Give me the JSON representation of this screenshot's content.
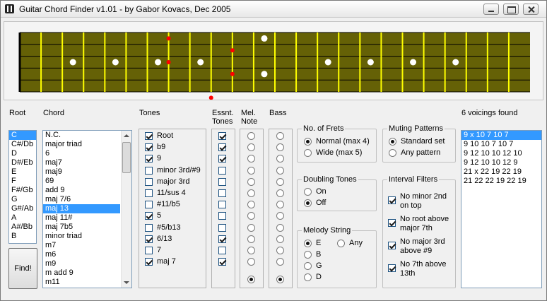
{
  "window": {
    "title": "Guitar Chord Finder  v1.01 - by Gabor Kovacs, Dec 2005"
  },
  "labels": {
    "root": "Root",
    "chord": "Chord",
    "tones": "Tones",
    "essnt1": "Essnt.",
    "essnt2": "Tones",
    "mel1": "Mel.",
    "mel2": "Note",
    "bass": "Bass",
    "voicings": "6 voicings found"
  },
  "roots": [
    "C",
    "C#/Db",
    "D",
    "D#/Eb",
    "E",
    "F",
    "F#/Gb",
    "G",
    "G#/Ab",
    "A",
    "A#/Bb",
    "B"
  ],
  "root_selected": 0,
  "chords": [
    "N.C.",
    "major triad",
    "6",
    "maj7",
    "maj9",
    "69",
    "add 9",
    "maj 7/6",
    "maj 13",
    "maj 11#",
    "maj 7b5",
    "minor triad",
    "m7",
    "m6",
    "m9",
    "m add 9",
    "m11"
  ],
  "chord_selected": 8,
  "tones": [
    {
      "label": "Root",
      "checked": true,
      "essential": true,
      "melody": false,
      "bass": false
    },
    {
      "label": "b9",
      "checked": true,
      "essential": true,
      "melody": false,
      "bass": false
    },
    {
      "label": "9",
      "checked": true,
      "essential": true,
      "melody": false,
      "bass": false
    },
    {
      "label": "minor 3rd/#9",
      "checked": false,
      "essential": false,
      "melody": false,
      "bass": false
    },
    {
      "label": "major 3rd",
      "checked": false,
      "essential": false,
      "melody": false,
      "bass": false
    },
    {
      "label": "11/sus 4",
      "checked": false,
      "essential": false,
      "melody": false,
      "bass": false
    },
    {
      "label": "#11/b5",
      "checked": false,
      "essential": false,
      "melody": false,
      "bass": false
    },
    {
      "label": "5",
      "checked": true,
      "essential": false,
      "melody": false,
      "bass": false
    },
    {
      "label": "#5/b13",
      "checked": false,
      "essential": false,
      "melody": false,
      "bass": false
    },
    {
      "label": "6/13",
      "checked": true,
      "essential": true,
      "melody": false,
      "bass": false
    },
    {
      "label": "7",
      "checked": false,
      "essential": false,
      "melody": false,
      "bass": false
    },
    {
      "label": "maj 7",
      "checked": true,
      "essential": true,
      "melody": false,
      "bass": false
    }
  ],
  "extra_radio": {
    "melody": true,
    "bass": true
  },
  "no_of_frets": {
    "title": "No. of Frets",
    "options": [
      "Normal (max 4)",
      "Wide (max 5)"
    ],
    "selected": 0
  },
  "muting": {
    "title": "Muting Patterns",
    "options": [
      "Standard set",
      "Any pattern"
    ],
    "selected": 0
  },
  "doubling": {
    "title": "Doubling Tones",
    "options": [
      "On",
      "Off"
    ],
    "selected": 1
  },
  "interval_filters": {
    "title": "Interval Filters",
    "options": [
      {
        "line1": "No minor 2nd",
        "line2": "on top",
        "checked": true
      },
      {
        "line1": "No root above",
        "line2": "major 7th",
        "checked": true
      },
      {
        "line1": "No major 3rd",
        "line2": "above #9",
        "checked": true
      },
      {
        "line1": "No 7th above",
        "line2": "13th",
        "checked": true
      }
    ]
  },
  "melody_string": {
    "title": "Melody String",
    "options": [
      "E",
      "B",
      "G",
      "D"
    ],
    "any": "Any",
    "selected": 0
  },
  "find_label": "Find!",
  "voicings": [
    "9 x 10 7 10 7",
    "9 10 10 7 10 7",
    "9 12 10 10 12 10",
    "9 12 10 10 12 9",
    "21 x 22 19 22 19",
    "21 22 22 19 22 19"
  ],
  "voicing_selected": 0,
  "colors": {
    "board": "#656106",
    "fret": "#ffff00",
    "note": "#ff0000",
    "marker": "#ffffff",
    "string": "#000000",
    "selection": "#3399ff"
  },
  "fretboard": {
    "frets": 24,
    "strings": 6,
    "inlays": [
      3,
      5,
      7,
      9,
      12,
      15,
      17,
      19,
      21
    ],
    "double_inlays": [
      12
    ],
    "notes": [
      {
        "fret": 7,
        "string": 1
      },
      {
        "fret": 7,
        "string": 3
      },
      {
        "fret": 10,
        "string": 2
      },
      {
        "fret": 10,
        "string": 4
      },
      {
        "fret": 9,
        "string": 6
      }
    ]
  }
}
